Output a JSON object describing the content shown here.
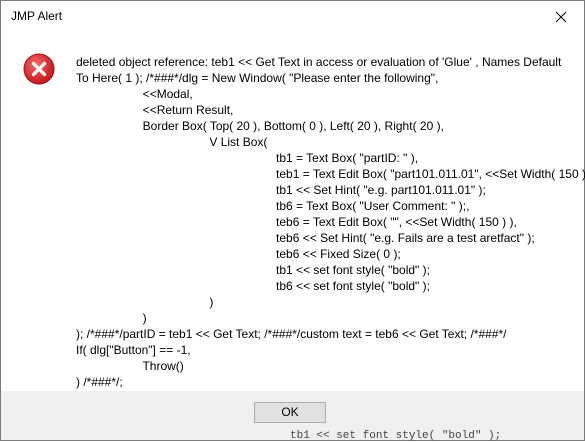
{
  "window": {
    "title": "JMP Alert"
  },
  "icons": {
    "error": "error-circle-x-icon",
    "close": "close-icon",
    "error_color": "#e81123"
  },
  "message": {
    "lines": [
      "deleted object reference: teb1 << Get Text in access or evaluation of 'Glue' , Names Default To Here( 1 ); /*###*/dlg = New Window( \"Please enter the following\",",
      "                    <<Modal,",
      "                    <<Return Result,",
      "                    Border Box( Top( 20 ), Bottom( 0 ), Left( 20 ), Right( 20 ),",
      "                                        V List Box(",
      "                                                            tb1 = Text Box( \"partID: \" ),",
      "                                                            teb1 = Text Edit Box( \"part101.011.01\", <<Set Width( 150 ) ),",
      "                                                            tb1 << Set Hint( \"e.g. part101.011.01\" );",
      "                                                            tb6 = Text Box( \"User Comment: \" );,",
      "                                                            teb6 = Text Edit Box( \"\", <<Set Width( 150 ) ),",
      "                                                            teb6 << Set Hint( \"e.g. Fails are a test aretfact\" );",
      "                                                            teb6 << Fixed Size( 0 );",
      "                                                            tb1 << set font style( \"bold\" );",
      "                                                            tb6 << set font style( \"bold\" );",
      "                                        )",
      "                    )",
      "); /*###*/partID = teb1 << Get Text; /*###*/custom text = teb6 << Get Text; /*###*/",
      "If( dlg[\"Button\"] == -1,",
      "                    Throw()",
      ") /*###*/;"
    ]
  },
  "footer": {
    "ok_label": "OK"
  },
  "background": {
    "snippet": "tb1 << set font style( \"bold\" );"
  }
}
